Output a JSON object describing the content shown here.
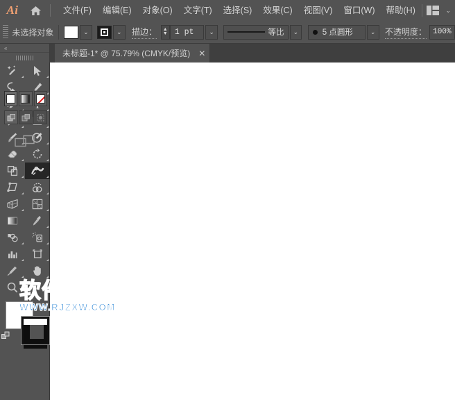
{
  "app": {
    "name": "Adobe Illustrator",
    "logo_text": "Ai",
    "accent_color": "#f2a172",
    "chrome_color": "#535353",
    "canvas_color": "#ffffff"
  },
  "menubar": {
    "home_icon": "home-icon",
    "workspace_icon": "workspace-switcher-icon",
    "workspace_chevron": "⌄",
    "items": [
      {
        "label": "文件(F)"
      },
      {
        "label": "编辑(E)"
      },
      {
        "label": "对象(O)"
      },
      {
        "label": "文字(T)"
      },
      {
        "label": "选择(S)"
      },
      {
        "label": "效果(C)"
      },
      {
        "label": "视图(V)"
      },
      {
        "label": "窗口(W)"
      },
      {
        "label": "帮助(H)"
      }
    ]
  },
  "optionsbar": {
    "selection_status": "未选择对象",
    "fill_swatch": {
      "name": "fill-swatch",
      "color": "#ffffff"
    },
    "fill_dropdown_chevron": "⌄",
    "stroke_swatch": {
      "name": "stroke-swatch",
      "color": "#000000"
    },
    "stroke_dropdown_chevron": "⌄",
    "stroke_label": "描边：",
    "stroke_weight_value": "1 pt",
    "stroke_weight_chevron": "⌄",
    "stroke_profile_value": "等比",
    "stroke_profile_chevron": "⌄",
    "brush_value": "5 点圆形",
    "brush_chevron": "⌄",
    "opacity_label": "不透明度：",
    "opacity_value": "100%"
  },
  "toolpanel": {
    "collapse_glyph": "«",
    "tools": [
      {
        "name": "magic-wand-tool",
        "label": "魔棒工具",
        "has_flyout": true,
        "active": false
      },
      {
        "name": "selection-tool",
        "label": "选择工具",
        "has_flyout": true,
        "active": false
      },
      {
        "name": "lasso-tool",
        "label": "套索工具",
        "has_flyout": false,
        "active": false
      },
      {
        "name": "pen-tool",
        "label": "钢笔工具",
        "has_flyout": true,
        "active": false
      },
      {
        "name": "curvature-tool",
        "label": "曲率工具",
        "has_flyout": true,
        "active": false
      },
      {
        "name": "type-tool",
        "label": "文字工具",
        "has_flyout": true,
        "active": false
      },
      {
        "name": "line-segment-tool",
        "label": "直线段工具",
        "has_flyout": true,
        "active": false
      },
      {
        "name": "rectangle-tool",
        "label": "矩形工具",
        "has_flyout": true,
        "active": false
      },
      {
        "name": "paintbrush-tool",
        "label": "画笔工具",
        "has_flyout": true,
        "active": false
      },
      {
        "name": "shaper-tool",
        "label": "Shaper 工具",
        "has_flyout": true,
        "active": false
      },
      {
        "name": "eraser-tool",
        "label": "橡皮擦工具",
        "has_flyout": true,
        "active": false
      },
      {
        "name": "rotate-tool",
        "label": "旋转工具",
        "has_flyout": true,
        "active": false
      },
      {
        "name": "scale-tool",
        "label": "缩放工具",
        "has_flyout": true,
        "active": false
      },
      {
        "name": "width-tool",
        "label": "宽度工具",
        "has_flyout": true,
        "active": true
      },
      {
        "name": "free-transform-tool",
        "label": "自由变换工具",
        "has_flyout": true,
        "active": false
      },
      {
        "name": "shape-builder-tool",
        "label": "形状生成器工具",
        "has_flyout": true,
        "active": false
      },
      {
        "name": "perspective-grid-tool",
        "label": "透视网格工具",
        "has_flyout": true,
        "active": false
      },
      {
        "name": "mesh-tool",
        "label": "网格工具",
        "has_flyout": true,
        "active": false
      },
      {
        "name": "gradient-tool",
        "label": "渐变工具",
        "has_flyout": false,
        "active": false
      },
      {
        "name": "eyedropper-tool",
        "label": "吸管工具",
        "has_flyout": true,
        "active": false
      },
      {
        "name": "blend-tool",
        "label": "混合工具",
        "has_flyout": true,
        "active": false
      },
      {
        "name": "symbol-sprayer-tool",
        "label": "符号喷枪工具",
        "has_flyout": true,
        "active": false
      },
      {
        "name": "column-graph-tool",
        "label": "柱形图工具",
        "has_flyout": true,
        "active": false
      },
      {
        "name": "artboard-tool",
        "label": "画板工具",
        "has_flyout": true,
        "active": false
      },
      {
        "name": "slice-tool",
        "label": "切片工具",
        "has_flyout": true,
        "active": false
      },
      {
        "name": "hand-tool",
        "label": "抓手工具",
        "has_flyout": true,
        "active": false
      },
      {
        "name": "zoom-tool",
        "label": "缩放工具",
        "has_flyout": false,
        "active": false
      }
    ],
    "color_controls": {
      "fill_color": "#ffffff",
      "stroke_color": "#000000",
      "swap_icon": "swap-fill-stroke-icon",
      "default_icon": "default-fill-stroke-icon"
    },
    "paint_modes": [
      {
        "name": "color-mode-button",
        "selected": true
      },
      {
        "name": "gradient-mode-button",
        "selected": false
      },
      {
        "name": "none-mode-button",
        "selected": false
      }
    ],
    "draw_modes": [
      {
        "name": "draw-normal-button",
        "selected": true
      },
      {
        "name": "draw-behind-button",
        "selected": false
      },
      {
        "name": "draw-inside-button",
        "selected": false
      }
    ],
    "screen_mode": {
      "name": "change-screen-mode-button"
    }
  },
  "tabstrip": {
    "document_title": "未标题-1* @ 75.79% (CMYK/预览)",
    "close_glyph": "✕"
  },
  "watermark": {
    "chinese": "软件自学网",
    "url": "WWW.RJZXW.COM",
    "color": "#1f7fd4"
  }
}
